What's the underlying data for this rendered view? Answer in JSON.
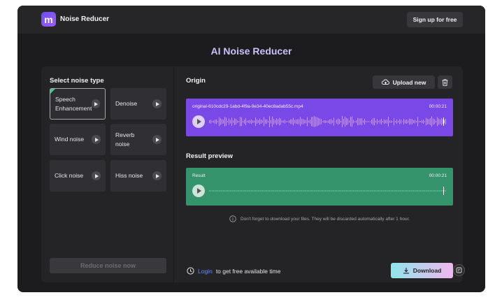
{
  "header": {
    "brand": "Noise Reducer",
    "signup_label": "Sign up for free",
    "logo_icon": "m-logo-icon"
  },
  "page": {
    "title": "AI Noise Reducer"
  },
  "noise_panel": {
    "section_label": "Select noise type",
    "types": [
      {
        "label": "Speech Enhancement",
        "selected": true
      },
      {
        "label": "Denoise",
        "selected": false
      },
      {
        "label": "Wind noise",
        "selected": false
      },
      {
        "label": "Reverb noise",
        "selected": false
      },
      {
        "label": "Click noise",
        "selected": false
      },
      {
        "label": "Hiss noise",
        "selected": false
      }
    ],
    "reduce_label": "Reduce noise now"
  },
  "origin": {
    "section_label": "Origin",
    "upload_label": "Upload new",
    "file_name": "original-610cdc29-1abd-4f9a-9e34-40ec8adab55c.mp4",
    "duration": "00:00:21"
  },
  "result": {
    "section_label": "Result preview",
    "name": "Result",
    "duration": "00:00:21"
  },
  "notice": "Don't forget to download your files. They will be discarded automatically after 1 hour.",
  "login": {
    "link": "Login",
    "text": "to get free available time"
  },
  "download_label": "Download",
  "colors": {
    "origin_track": "#7b48e8",
    "result_track": "#34936b",
    "accent_link": "#6d8cff"
  }
}
